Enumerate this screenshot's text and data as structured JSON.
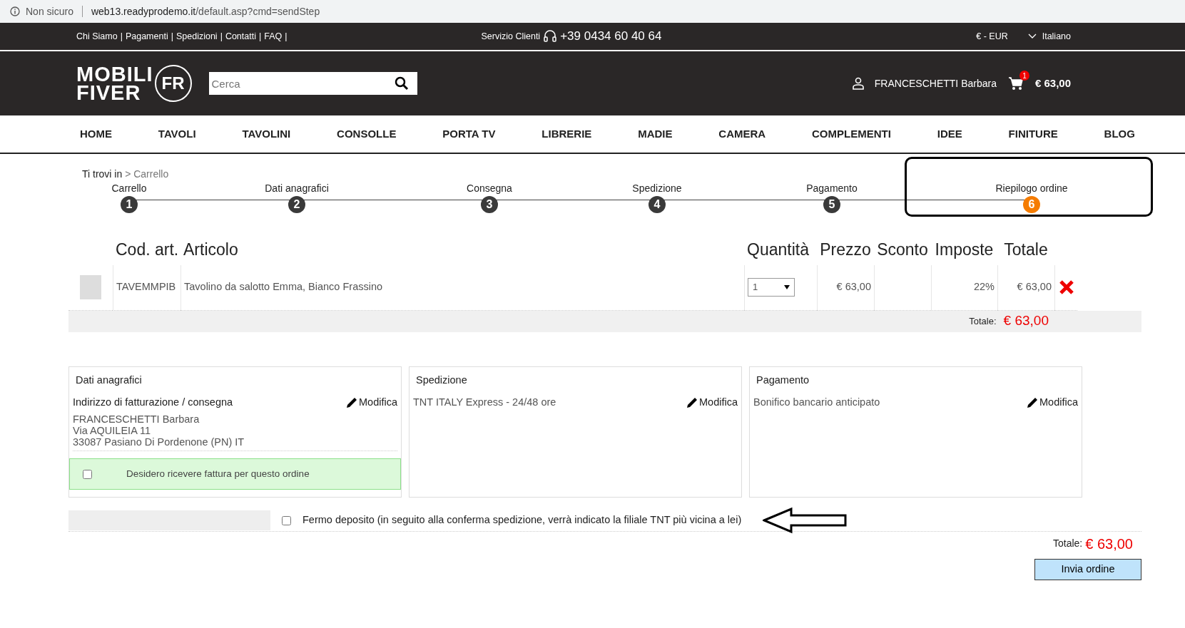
{
  "browser": {
    "security": "Non sicuro",
    "url_host": "web13.readyprodemo.it",
    "url_path": "/default.asp?cmd=sendStep"
  },
  "top_bar": {
    "links": [
      "Chi Siamo",
      "Pagamenti",
      "Spedizioni",
      "Contatti",
      "FAQ"
    ],
    "separator": "|",
    "service_label": "Servizio Clienti",
    "phone": "+39 0434 60 40 64",
    "currency": "€ - EUR",
    "language": "Italiano"
  },
  "header": {
    "logo_line1": "MOBILI",
    "logo_line2": "FIVER",
    "logo_mark": "FR",
    "search": {
      "placeholder": "Cerca"
    },
    "user": "FRANCESCHETTI Barbara",
    "cart_count": "1",
    "cart_total": "€ 63,00"
  },
  "nav": [
    "HOME",
    "TAVOLI",
    "TAVOLINI",
    "CONSOLLE",
    "PORTA TV",
    "LIBRERIE",
    "MADIE",
    "CAMERA",
    "COMPLEMENTI",
    "IDEE",
    "FINITURE",
    "BLOG"
  ],
  "breadcrumb": {
    "label": "Ti trovi in",
    "separator": ">",
    "current": "Carrello"
  },
  "steps": [
    {
      "label": "Carrello",
      "number": "1",
      "selected": false,
      "highlighted": false
    },
    {
      "label": "Dati anagrafici",
      "number": "2",
      "selected": false,
      "highlighted": false
    },
    {
      "label": "Consegna",
      "number": "3",
      "selected": false,
      "highlighted": false
    },
    {
      "label": "Spedizione",
      "number": "4",
      "selected": false,
      "highlighted": false
    },
    {
      "label": "Pagamento",
      "number": "5",
      "selected": false,
      "highlighted": false
    },
    {
      "label": "Riepilogo ordine",
      "number": "6",
      "selected": true,
      "highlighted": true
    }
  ],
  "cart": {
    "columns": [
      "Cod. art.",
      "Articolo",
      "Quantità",
      "Prezzo",
      "Sconto",
      "Imposte",
      "Totale"
    ],
    "rows": [
      {
        "code": "TAVEMMPIB",
        "article": "Tavolino da salotto Emma, Bianco Frassino",
        "quantity": "1",
        "price": "€ 63,00",
        "tax": "22%",
        "total": "€ 63,00"
      }
    ],
    "total_label": "Totale:",
    "total": "€ 63,00"
  },
  "panels": [
    {
      "title": "Dati anagrafici",
      "heading": "Indirizzo di fatturazione / consegna",
      "edit": "Modifica",
      "lines": [
        "FRANCESCHETTI Barbara",
        "Via AQUILEIA 11",
        "33087 Pasiano Di Pordenone (PN) IT"
      ],
      "option": {
        "label": "Desidero ricevere fattura per questo ordine",
        "checked": false
      }
    },
    {
      "title": "Spedizione",
      "heading": "TNT ITALY Express - 24/48 ore",
      "edit": "Modifica"
    },
    {
      "title": "Pagamento",
      "heading": "Bonifico bancario anticipato",
      "edit": "Modifica"
    }
  ],
  "pickup": {
    "label": "Fermo deposito (in seguito alla conferma spedizione, verrà indicato la filiale TNT più vicina a lei)",
    "checked": false,
    "arrow": true
  },
  "summary": {
    "total_label": "Totale:",
    "total": "€ 63,00",
    "submit": "Invia ordine"
  }
}
